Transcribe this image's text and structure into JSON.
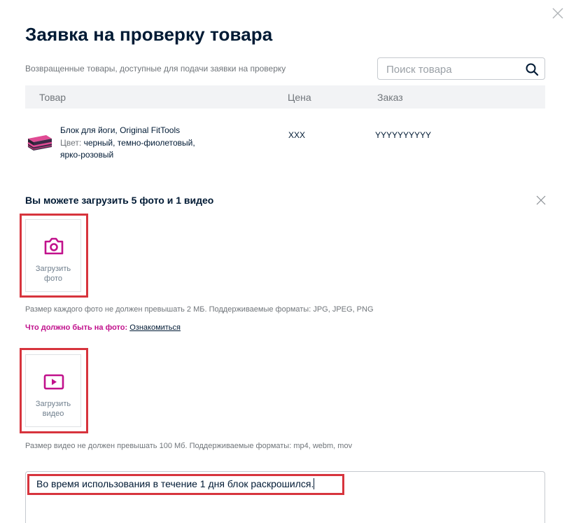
{
  "modal": {
    "title": "Заявка на проверку товара",
    "subtitle": "Возвращенные товары, доступные для подачи заявки на проверку"
  },
  "search": {
    "placeholder": "Поиск товара",
    "icon": "search-icon"
  },
  "table": {
    "headers": [
      "Товар",
      "Цена",
      "Заказ"
    ],
    "rows": [
      {
        "name": "Блок для йоги, Original FitTools",
        "color_label": "Цвет:",
        "color_value": "черный, темно-фиолетовый, ярко-розовый",
        "price": "XXX",
        "order": "YYYYYYYYYY"
      }
    ]
  },
  "upload": {
    "title": "Вы можете загрузить 5 фото и 1 видео",
    "photo_button": "Загрузить фото",
    "photo_hint": "Размер каждого фото не должен превышать 2 МБ. Поддерживаемые форматы: JPG, JPEG, PNG",
    "photo_requirements_question": "Что должно быть на фото:",
    "photo_requirements_link": "Ознакомиться",
    "video_button": "Загрузить видео",
    "video_hint": "Размер видео не должен превышать 100 Мб. Поддерживаемые форматы: mp4, webm, mov"
  },
  "comment": {
    "value": "Во время использования в течение 1 дня блок раскрошился."
  },
  "colors": {
    "accent": "#c1118c",
    "highlight": "#d7343d",
    "text": "#001a34",
    "muted": "#70757a"
  }
}
